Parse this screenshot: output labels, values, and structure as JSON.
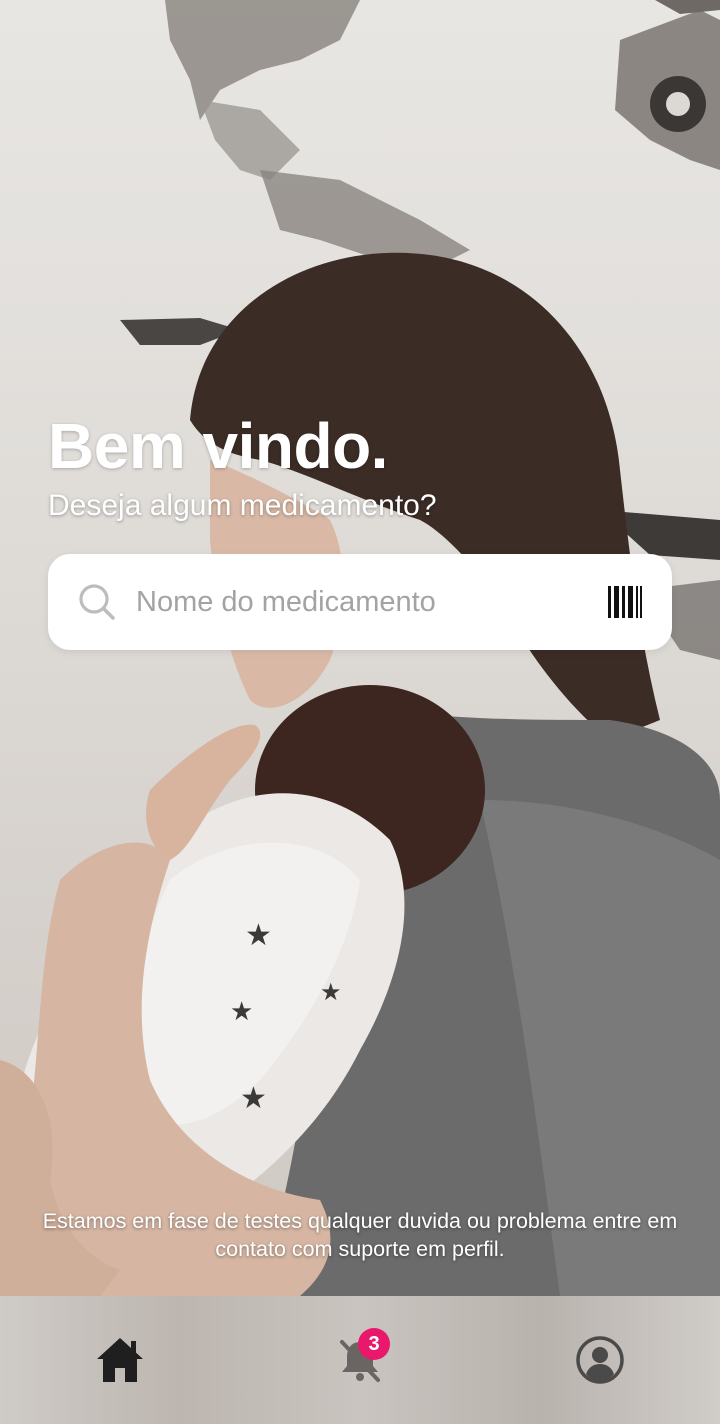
{
  "header": {
    "title": "Bem vindo.",
    "subtitle": "Deseja algum medicamento?"
  },
  "search": {
    "placeholder": "Nome do medicamento",
    "value": "",
    "icon": "search-icon",
    "scan_icon": "barcode-icon"
  },
  "notice": {
    "text": "Estamos em fase de testes qualquer duvida ou problema entre em contato com suporte em perfil."
  },
  "nav": {
    "items": [
      {
        "name": "home",
        "icon": "home-icon"
      },
      {
        "name": "notifications",
        "icon": "bell-off-icon",
        "badge": "3"
      },
      {
        "name": "profile",
        "icon": "user-circle-icon"
      }
    ]
  },
  "colors": {
    "badge": "#e8196b",
    "search_bg": "#ffffff",
    "placeholder": "#a3a3a3",
    "icon_dark": "#1f1f1f"
  }
}
